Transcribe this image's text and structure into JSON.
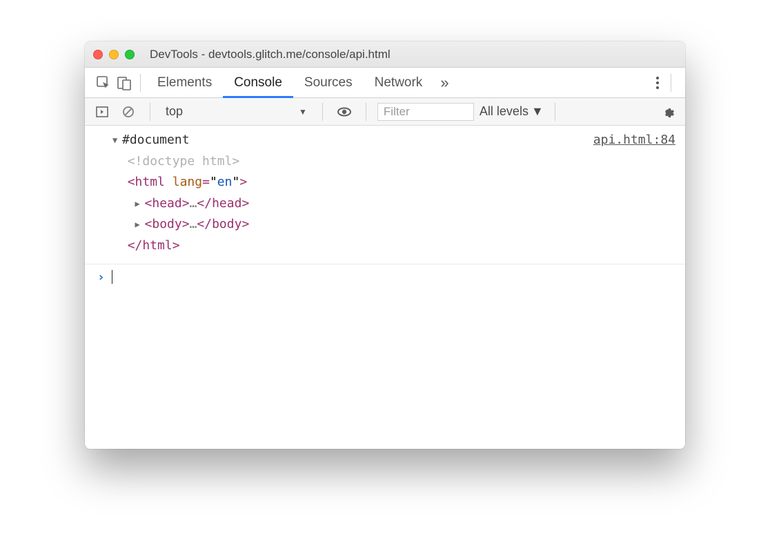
{
  "window": {
    "title": "DevTools - devtools.glitch.me/console/api.html"
  },
  "tabs": {
    "items": [
      "Elements",
      "Console",
      "Sources",
      "Network"
    ],
    "active_index": 1,
    "overflow_glyph": "»"
  },
  "filterbar": {
    "context": "top",
    "filter_placeholder": "Filter",
    "levels_label": "All levels"
  },
  "console": {
    "source_link": "api.html:84",
    "tree": {
      "root_label": "#document",
      "doctype_text": "<!doctype html>",
      "html_open_tag": "html",
      "html_attr_name": "lang",
      "html_attr_value": "en",
      "head_tag": "head",
      "body_tag": "body",
      "ellipsis": "…"
    }
  }
}
